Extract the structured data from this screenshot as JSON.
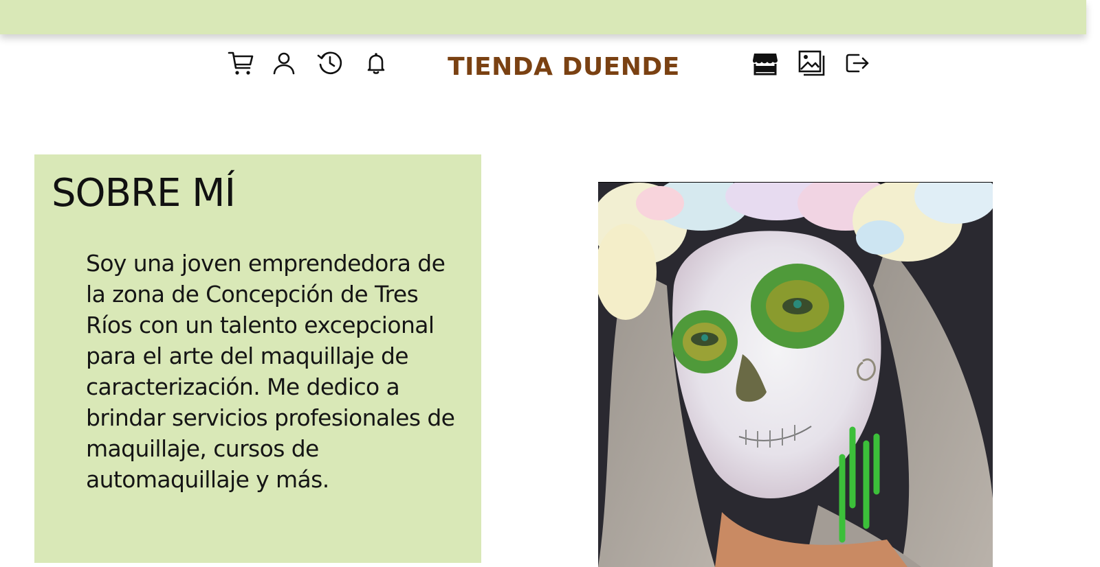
{
  "header": {
    "brand": "TIENDA DUENDE",
    "icons_left": [
      "cart-icon",
      "user-icon",
      "history-icon",
      "bell-icon"
    ],
    "icons_right": [
      "store-icon",
      "gallery-icon",
      "logout-icon"
    ]
  },
  "about": {
    "title": "SOBRE MÍ",
    "text": "Soy una joven emprendedora de la zona de Concepción de Tres Ríos con un talento excepcional para el arte del maquillaje de caracterización. Me dedico a brindar servicios profesionales de maquillaje, cursos de automaquillaje y más."
  },
  "colors": {
    "topbar": "#d9e8b7",
    "panel": "#d9e8b7",
    "brand": "#7a4112"
  }
}
